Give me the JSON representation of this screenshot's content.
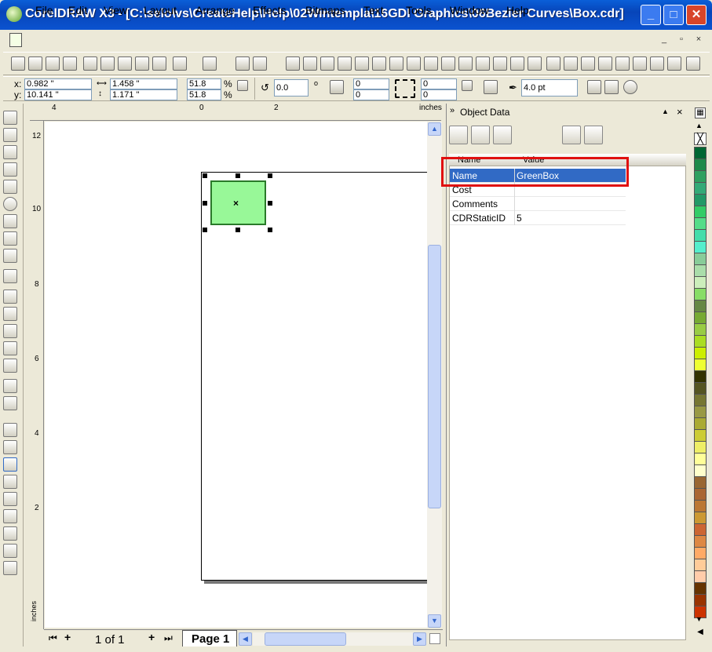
{
  "window": {
    "title": "CorelDRAW X3 - [C:\\selo\\vs\\CreateHelp\\Help\\02Wintempla\\16GDI Graphics\\06Bezier Curves\\Box.cdr]",
    "minimize": "_",
    "maximize": "□",
    "close": "✕"
  },
  "menu": {
    "items": [
      "File",
      "Edit",
      "View",
      "Layout",
      "Arrange",
      "Effects",
      "Bitmaps",
      "Text",
      "Tools",
      "Window",
      "Help"
    ],
    "mdi": [
      "_",
      "▫",
      "×"
    ]
  },
  "propbar": {
    "x_label": "x:",
    "x": "0.982 \"",
    "y_label": "y:",
    "y": "10.141 \"",
    "w": "1.458 \"",
    "h": "1.171 \"",
    "scale_x": "51.8",
    "scale_y": "51.8",
    "pct": "%",
    "angle": "0.0",
    "deg": "o",
    "corner1": "0",
    "corner2": "0",
    "corner3": "0",
    "corner4": "0",
    "outline": "4.0 pt"
  },
  "ruler": {
    "top": [
      "4",
      "0",
      "2"
    ],
    "unit": "inches",
    "left": [
      "12",
      "10",
      "8",
      "6",
      "4",
      "2"
    ],
    "left_unit": "inches"
  },
  "docker": {
    "title": "Object Data",
    "col_name": "Name",
    "col_value": "Value",
    "rows": [
      {
        "name": "Name",
        "value": "GreenBox"
      },
      {
        "name": "Cost",
        "value": ""
      },
      {
        "name": "Comments",
        "value": ""
      },
      {
        "name": "CDRStaticID",
        "value": "5"
      }
    ]
  },
  "pages": {
    "counter": "1 of 1",
    "tab": "Page 1"
  },
  "colors": {
    "shape_fill": "#98F898",
    "shape_outline": "#2A7A2A",
    "selection": "#316AC5",
    "highlight": "#E01010"
  },
  "palette": [
    "#006633",
    "#1E8A4A",
    "#2FA060",
    "#33AA77",
    "#229966",
    "#33CC66",
    "#55DD88",
    "#44DDAA",
    "#55EECC",
    "#88CC99",
    "#AADDAA",
    "#CCEEBB",
    "#88DD66",
    "#668844",
    "#77AA33",
    "#99CC44",
    "#AADD22",
    "#CCEE00",
    "#EEFF33",
    "#333300",
    "#555522",
    "#777733",
    "#999944",
    "#AAAA33",
    "#CCCC33",
    "#EEEE66",
    "#FFFF99",
    "#FFFFCC",
    "#996633",
    "#AA6633",
    "#BB7733",
    "#CC9933",
    "#CC6633",
    "#DD8844",
    "#FFAA66",
    "#FFCC99",
    "#FFCCAA",
    "#663300",
    "#993300",
    "#CC3300"
  ]
}
